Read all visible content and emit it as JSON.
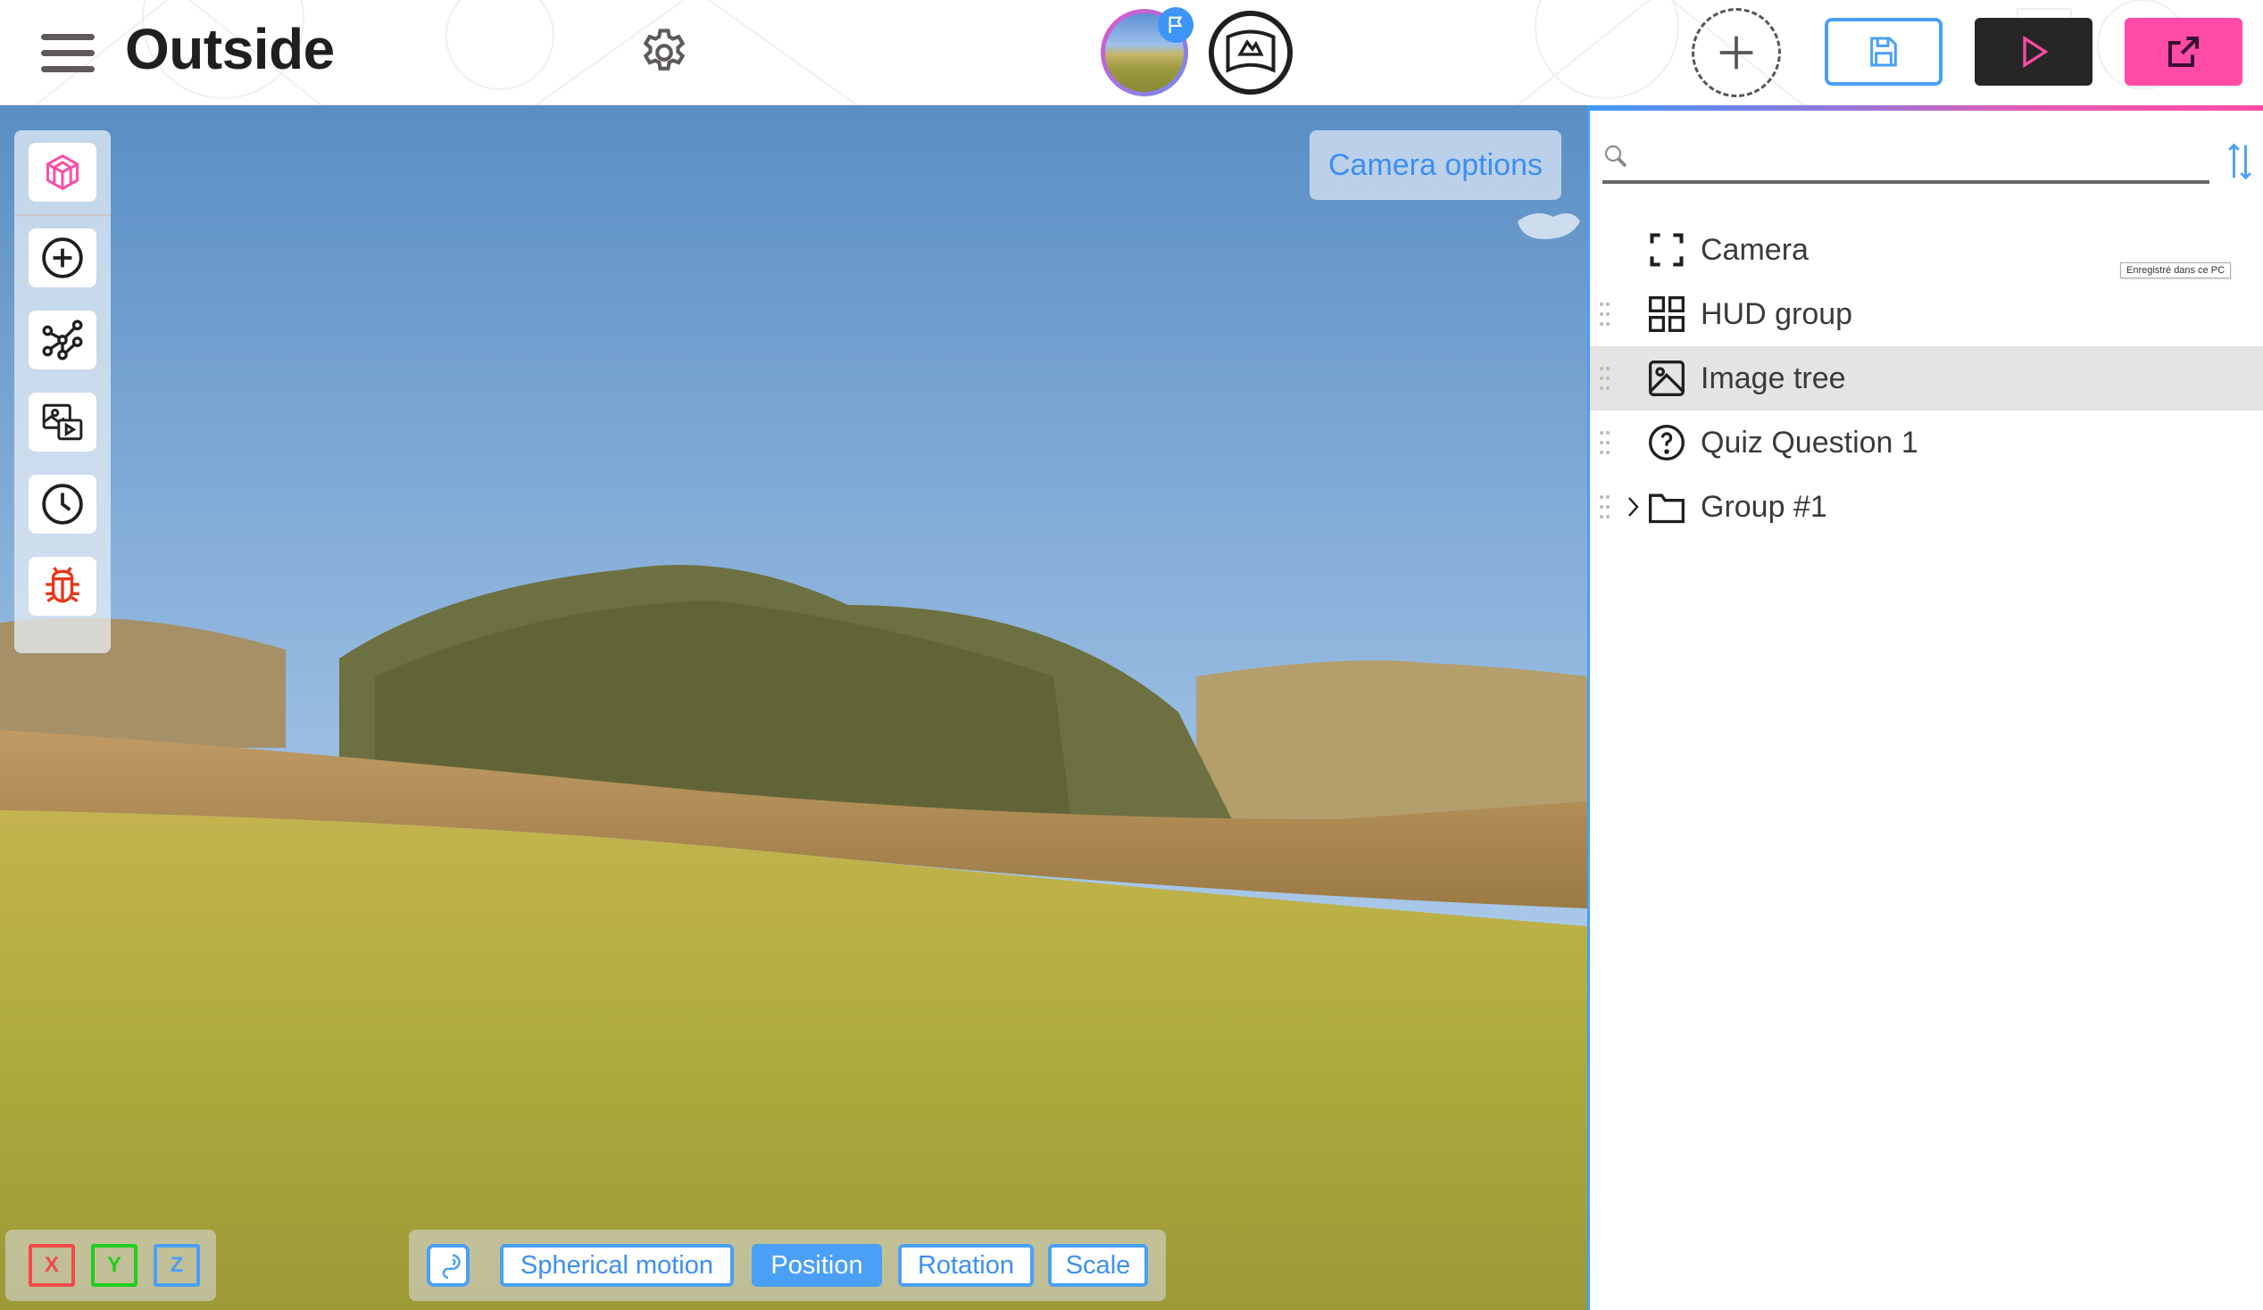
{
  "header": {
    "title": "Outside",
    "menu_icon": "hamburger-menu-icon",
    "settings_icon": "gear-icon",
    "scene_thumbnail_icon": "scene-thumbnail",
    "scene_flag_icon": "flag-icon",
    "vr_icon": "vr-panorama-icon",
    "add_icon": "plus-icon",
    "save_icon": "floppy-disk-icon",
    "play_icon": "play-icon",
    "export_icon": "external-link-icon"
  },
  "viewport": {
    "camera_options_label": "Camera options",
    "left_toolbar": [
      {
        "name": "3d-object",
        "icon": "cube-icon",
        "color": "#ff4aa6"
      },
      {
        "name": "add",
        "icon": "plus-circle-icon",
        "color": "#1f1f1f"
      },
      {
        "name": "graph",
        "icon": "node-graph-icon",
        "color": "#1f1f1f"
      },
      {
        "name": "media",
        "icon": "image-video-icon",
        "color": "#1f1f1f"
      },
      {
        "name": "history",
        "icon": "clock-icon",
        "color": "#1f1f1f"
      },
      {
        "name": "debug",
        "icon": "bug-icon",
        "color": "#e8361b"
      }
    ],
    "axes": [
      {
        "label": "X",
        "color": "#f24a4a"
      },
      {
        "label": "Y",
        "color": "#1fce1f"
      },
      {
        "label": "Z",
        "color": "#4aa0f7"
      }
    ],
    "snap_icon": "magnet-icon",
    "transform_modes": [
      {
        "label": "Spherical motion",
        "active": false
      },
      {
        "label": "Position",
        "active": true
      },
      {
        "label": "Rotation",
        "active": false
      },
      {
        "label": "Scale",
        "active": false
      }
    ]
  },
  "panel": {
    "search": {
      "placeholder": "",
      "value": ""
    },
    "sort_icon": "sort-arrows-icon",
    "tooltip": "Enregistré dans ce PC",
    "tree": [
      {
        "label": "Camera",
        "icon": "camera-frame-icon",
        "draggable": false,
        "expandable": false,
        "selected": false
      },
      {
        "label": "HUD group",
        "icon": "grid-icon",
        "draggable": true,
        "expandable": false,
        "selected": false
      },
      {
        "label": "Image tree",
        "icon": "image-icon",
        "draggable": true,
        "expandable": false,
        "selected": true
      },
      {
        "label": "Quiz Question 1",
        "icon": "question-circle-icon",
        "draggable": true,
        "expandable": false,
        "selected": false
      },
      {
        "label": "Group #1",
        "icon": "folder-icon",
        "draggable": true,
        "expandable": true,
        "selected": false
      }
    ]
  },
  "colors": {
    "accent_blue": "#4aa0f7",
    "accent_pink": "#ff4aa6",
    "dark": "#262626"
  }
}
